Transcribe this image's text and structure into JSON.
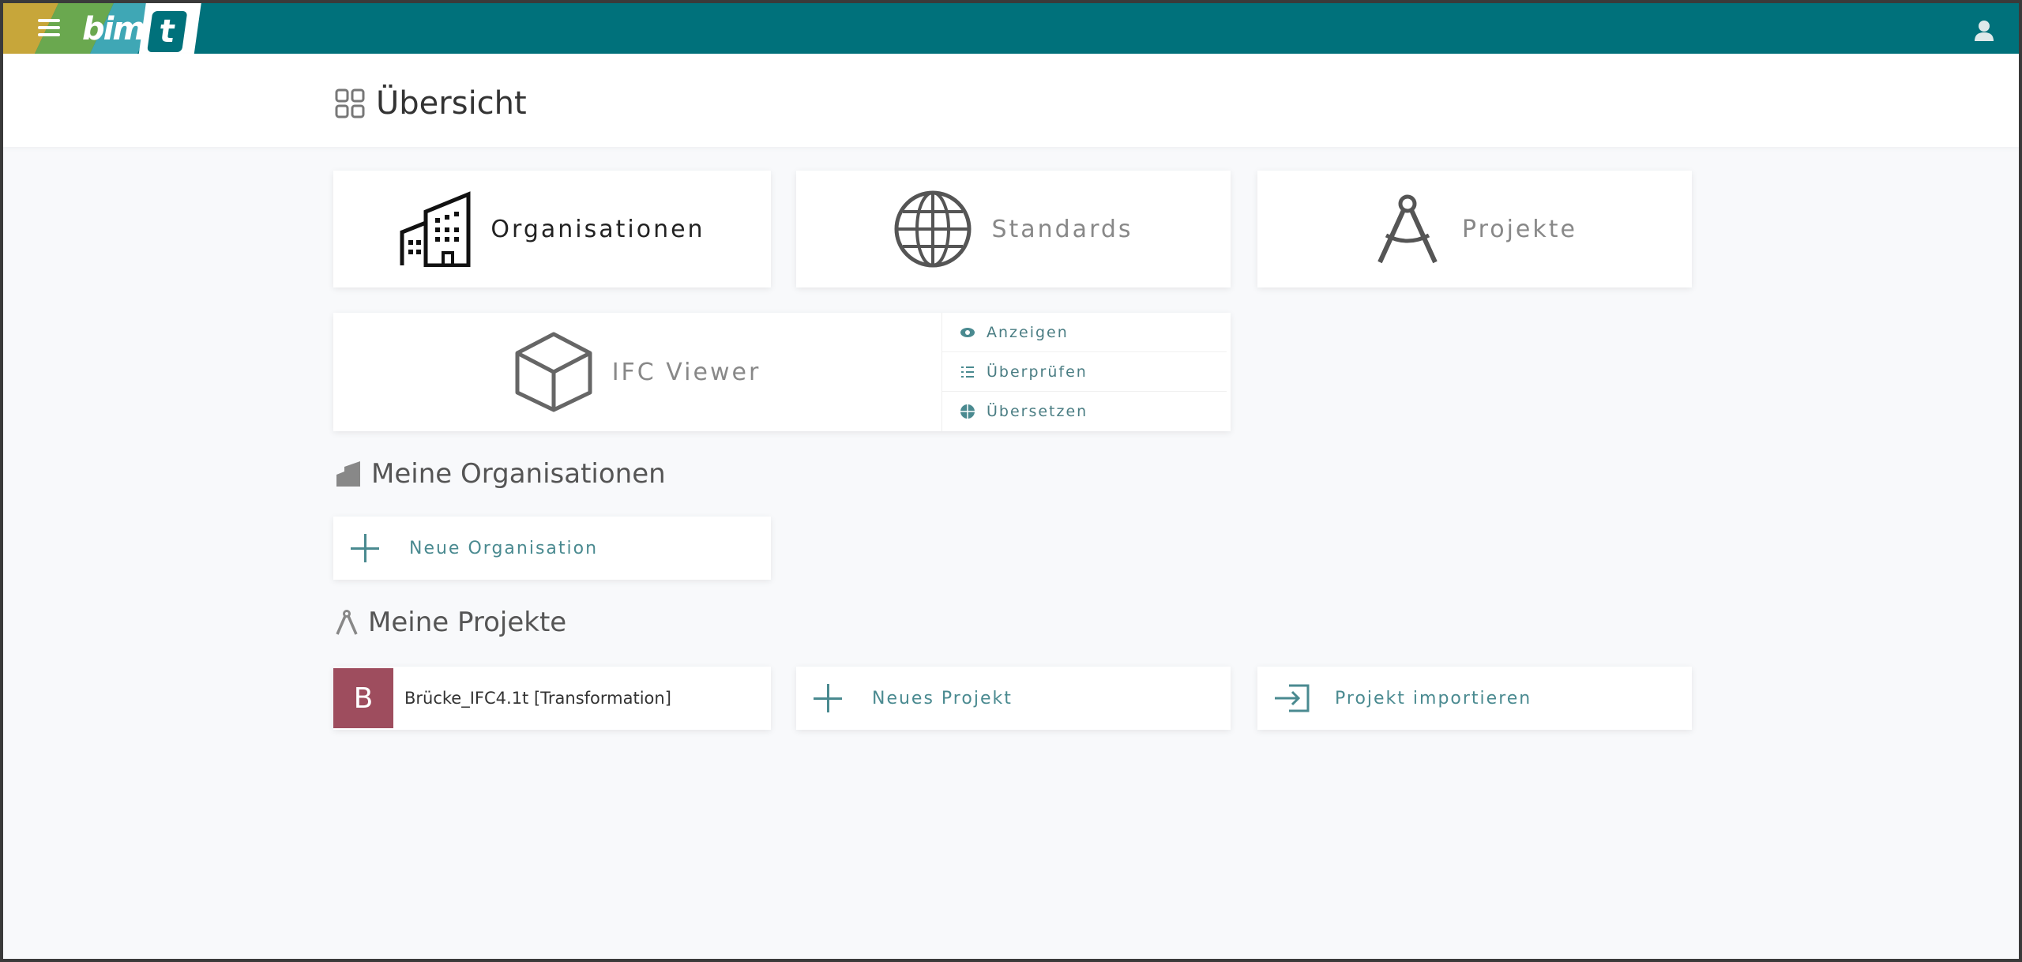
{
  "app": {
    "logo_text": "bim",
    "logo_badge": "t",
    "colors": {
      "primary": "#00717b",
      "avatar": "#9e4d5e",
      "accent_text": "#4a8a90"
    }
  },
  "header": {
    "icon": "grid-icon",
    "title": "Übersicht"
  },
  "tiles": {
    "organisationen": {
      "icon": "building-icon",
      "label": "Organisationen"
    },
    "standards": {
      "icon": "globe-icon",
      "label": "Standards"
    },
    "projekte": {
      "icon": "compass-icon",
      "label": "Projekte"
    },
    "ifc_viewer": {
      "icon": "cube-icon",
      "label": "IFC Viewer",
      "actions": [
        {
          "icon": "eye-icon",
          "label": "Anzeigen"
        },
        {
          "icon": "checklist-icon",
          "label": "Überprüfen"
        },
        {
          "icon": "globe-small-icon",
          "label": "Übersetzen"
        }
      ]
    }
  },
  "organisations_section": {
    "icon": "building-small-icon",
    "title": "Meine Organisationen",
    "new_label": "Neue Organisation"
  },
  "projects_section": {
    "icon": "compass-small-icon",
    "title": "Meine Projekte",
    "projects": [
      {
        "avatar_letter": "B",
        "name": "Brücke_IFC4.1t [Transformation]"
      }
    ],
    "new_label": "Neues Projekt",
    "import_label": "Projekt importieren"
  }
}
